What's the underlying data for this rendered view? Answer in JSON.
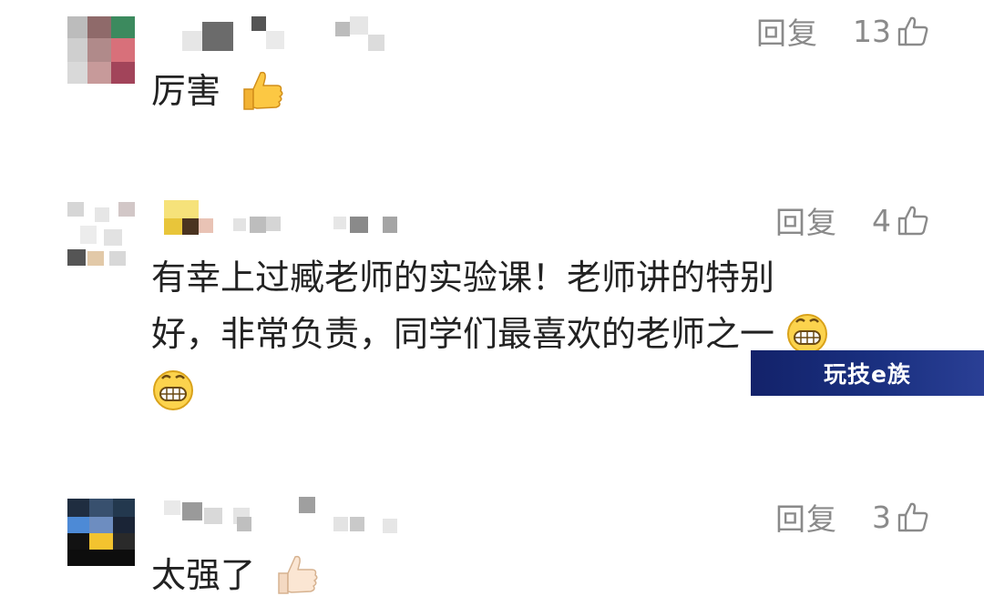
{
  "comments": [
    {
      "reply_label": "回复",
      "like_count": "13",
      "text_lines": [
        "厉害"
      ],
      "emoji": "thumbs-up-icon"
    },
    {
      "reply_label": "回复",
      "like_count": "4",
      "text_lines": [
        "有幸上过臧老师的实验课！老师讲的特别",
        "好，非常负责，同学们最喜欢的老师之一"
      ],
      "emoji": "grinning-face-icon"
    },
    {
      "reply_label": "回复",
      "like_count": "3",
      "text_lines": [
        "太强了"
      ],
      "emoji": "thumbs-up-light-icon"
    }
  ],
  "watermark": {
    "text": "玩技e族"
  },
  "colors": {
    "meta_text": "#8a8a8a",
    "body_text": "#222222",
    "watermark_bg": "#13226a"
  }
}
